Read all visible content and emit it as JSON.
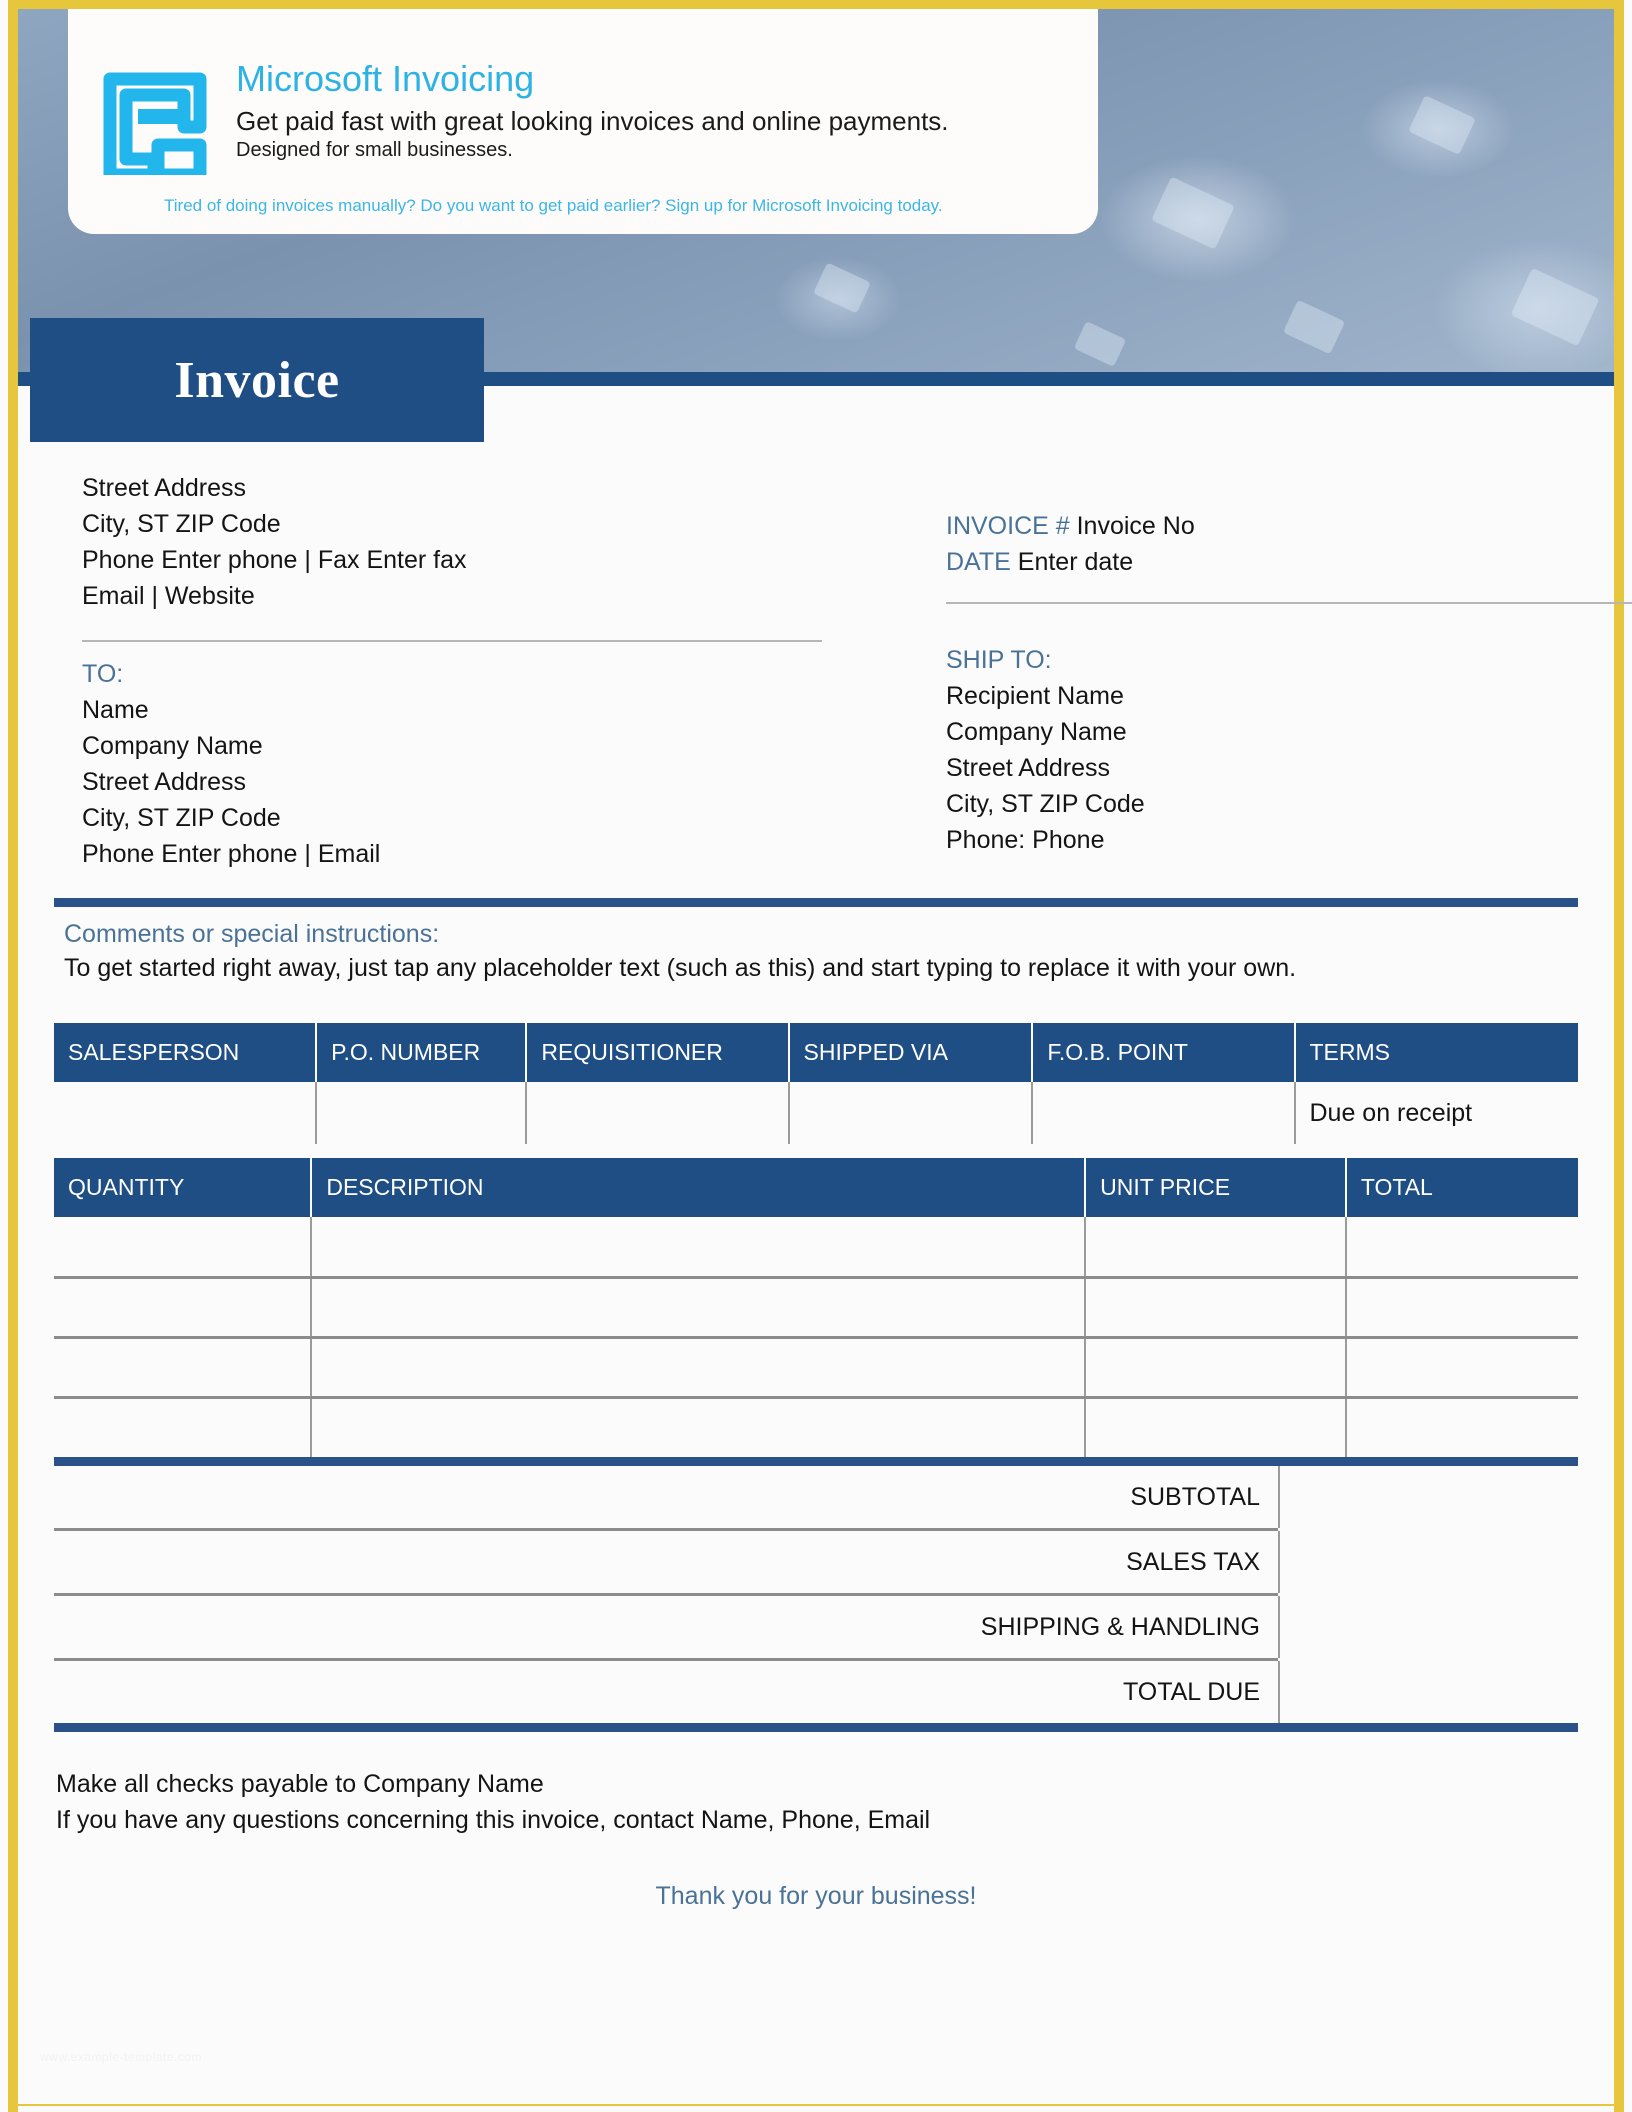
{
  "theme": {
    "border_gold": "#e6c73c",
    "dark_blue": "#1f4e85",
    "steel_blue": "#4a7296",
    "cyan": "#2cb3e4"
  },
  "promo": {
    "logo_icon": "invoice-document-icon",
    "title": "Microsoft Invoicing",
    "subtitle": "Get paid fast with great looking invoices and online payments.",
    "subtitle2": "Designed for small businesses.",
    "link": "Tired of doing invoices manually? Do you want to get paid earlier? Sign up for Microsoft Invoicing today."
  },
  "title_tab": {
    "label": "Invoice"
  },
  "sender": {
    "lines": [
      "Street Address",
      "City, ST ZIP Code",
      "Phone Enter phone | Fax Enter fax",
      "Email | Website"
    ]
  },
  "meta": {
    "invoice_label": "INVOICE #",
    "invoice_value": "Invoice No",
    "date_label": "DATE",
    "date_value": "Enter date"
  },
  "bill_to": {
    "label": "TO:",
    "lines": [
      "Name",
      "Company Name",
      "Street Address",
      "City, ST ZIP Code",
      "Phone Enter phone | Email"
    ]
  },
  "ship_to": {
    "label": "SHIP TO:",
    "lines": [
      "Recipient Name",
      "Company Name",
      "Street Address",
      "City, ST ZIP Code",
      "Phone: Phone"
    ]
  },
  "comments": {
    "label": "Comments or special instructions:",
    "body": "To get started right away, just tap any placeholder text (such as this) and start typing to replace it with your own."
  },
  "info_table": {
    "headers": [
      "SALESPERSON",
      "P.O. NUMBER",
      "REQUISITIONER",
      "SHIPPED VIA",
      "F.O.B. POINT",
      "TERMS"
    ],
    "row": [
      "",
      "",
      "",
      "",
      "",
      "Due on receipt"
    ]
  },
  "items_table": {
    "headers": [
      "QUANTITY",
      "DESCRIPTION",
      "UNIT PRICE",
      "TOTAL"
    ],
    "rows": [
      [
        "",
        "",
        "",
        ""
      ],
      [
        "",
        "",
        "",
        ""
      ],
      [
        "",
        "",
        "",
        ""
      ],
      [
        "",
        "",
        "",
        ""
      ]
    ]
  },
  "totals": [
    {
      "label": "SUBTOTAL",
      "value": ""
    },
    {
      "label": "SALES TAX",
      "value": ""
    },
    {
      "label": "SHIPPING & HANDLING",
      "value": ""
    },
    {
      "label": "TOTAL DUE",
      "value": ""
    }
  ],
  "footer": {
    "line1": "Make all checks payable to Company Name",
    "line2": "If you have any questions concerning this invoice, contact Name, Phone, Email",
    "thanks": "Thank you for your business!",
    "watermark": "www.example-template.com"
  }
}
